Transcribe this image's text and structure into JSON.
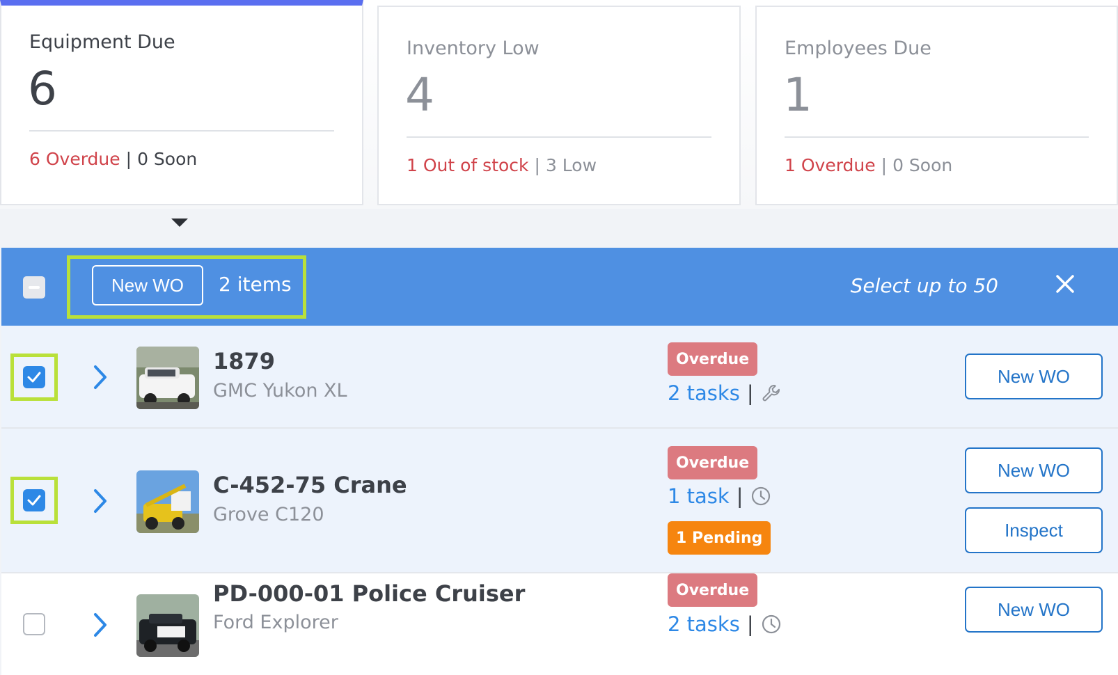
{
  "cards": [
    {
      "title": "Equipment Due",
      "count": "6",
      "red_text": "6 Overdue",
      "separator": "|",
      "secondary_text": "0 Soon"
    },
    {
      "title": "Inventory Low",
      "count": "4",
      "red_text": "1 Out of stock",
      "separator": "|",
      "secondary_text": "3 Low"
    },
    {
      "title": "Employees Due",
      "count": "1",
      "red_text": "1 Overdue",
      "separator": "|",
      "secondary_text": "0 Soon"
    }
  ],
  "selection_bar": {
    "new_wo_label": "New WO",
    "items_label": "2 items",
    "limit_label": "Select up to 50"
  },
  "rows": [
    {
      "id": "1879",
      "model": "GMC Yukon XL",
      "badge": "Overdue",
      "tasks": "2 tasks",
      "task_icon": "wrench-icon",
      "buttons": [
        "New WO"
      ],
      "selected": true
    },
    {
      "id": "C-452-75 Crane",
      "model": "Grove C120",
      "badge": "Overdue",
      "tasks": "1 task",
      "task_icon": "clock-icon",
      "pending": "1 Pending",
      "buttons": [
        "New WO",
        "Inspect"
      ],
      "selected": true
    },
    {
      "id": "PD-000-01 Police Cruiser",
      "model": "Ford Explorer",
      "badge": "Overdue",
      "tasks": "2 tasks",
      "task_icon": "clock-icon",
      "buttons": [
        "New WO"
      ],
      "selected": false
    }
  ],
  "colors": {
    "accent_blue": "#4f90e2",
    "overdue_red": "#d0434a",
    "pending_orange": "#f6850f",
    "highlight_green": "#b9e03a"
  }
}
